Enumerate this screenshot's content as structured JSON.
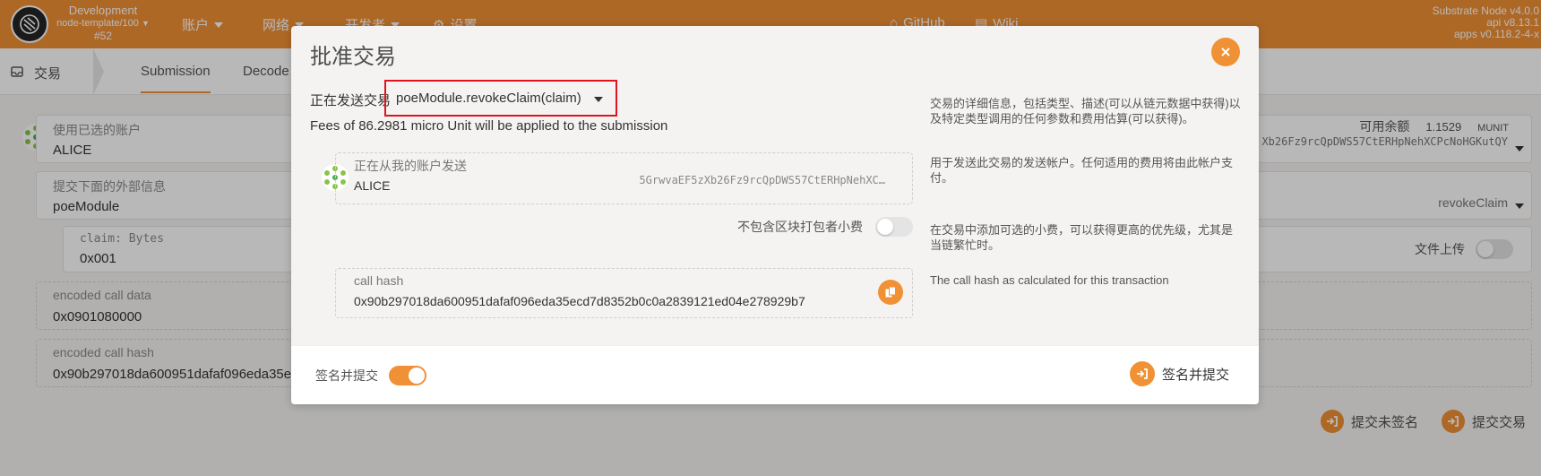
{
  "header": {
    "chain_name": "Development",
    "node_name": "node-template/100",
    "block": "#52",
    "nav": [
      {
        "label": "账户"
      },
      {
        "label": "网络"
      },
      {
        "label": "开发者"
      },
      {
        "label": "设置"
      }
    ],
    "links": [
      {
        "label": "GitHub"
      },
      {
        "label": "Wiki"
      }
    ],
    "version_node": "Substrate Node v4.0.0",
    "version_api": "api v8.13.1",
    "version_apps": "apps v0.118.2-4-x",
    "accent_color": "#f19135"
  },
  "subnav": {
    "home_label": "交易",
    "tabs": [
      {
        "label": "Submission",
        "active": true
      },
      {
        "label": "Decode",
        "active": false
      }
    ]
  },
  "form": {
    "account_label": "使用已选的账户",
    "account_name": "ALICE",
    "account_address_tail": "Xb26Fz9rcQpDWS57CtERHpNehXCPcNoHGKutQY",
    "balance_label": "可用余额",
    "balance_value": "1.1529",
    "balance_unit": "MUNIT",
    "extrinsic_label": "提交下面的外部信息",
    "extrinsic_module": "poeModule",
    "extrinsic_method": "revokeClaim",
    "param_label": "claim: Bytes",
    "param_value": "0x001",
    "file_upload_label": "文件上传",
    "encoded_data_label": "encoded call data",
    "encoded_data_value": "0x0901080000",
    "encoded_hash_label": "encoded call hash",
    "encoded_hash_value": "0x90b297018da600951dafaf096eda35ecd",
    "submit_unsigned_label": "提交未签名",
    "submit_label": "提交交易"
  },
  "modal": {
    "title": "批准交易",
    "sending_prefix": "正在发送交易",
    "method": "poeModule.revokeClaim(claim)",
    "fees": "Fees of 86.2981 micro Unit will be applied to the submission",
    "help_tx": "交易的详细信息，包括类型、描述(可以从链元数据中获得)以及特定类型调用的任何参数和费用估算(可以获得)。",
    "sender_label": "正在从我的账户发送",
    "sender_name": "ALICE",
    "sender_address": "5GrwvaEF5zXb26Fz9rcQpDWS57CtERHpNehXC…",
    "help_sender": "用于发送此交易的发送帐户。任何适用的费用将由此帐户支付。",
    "tip_label": "不包含区块打包者小费",
    "help_tip": "在交易中添加可选的小费，可以获得更高的优先级，尤其是当链繁忙时。",
    "call_hash_label": "call hash",
    "call_hash_value": "0x90b297018da600951dafaf096eda35ecd7d8352b0c0a2839121ed04e278929b7",
    "help_call_hash": "The call hash as calculated for this transaction",
    "sign_submit_toggle_label": "签名并提交",
    "sign_submit_button": "签名并提交"
  }
}
